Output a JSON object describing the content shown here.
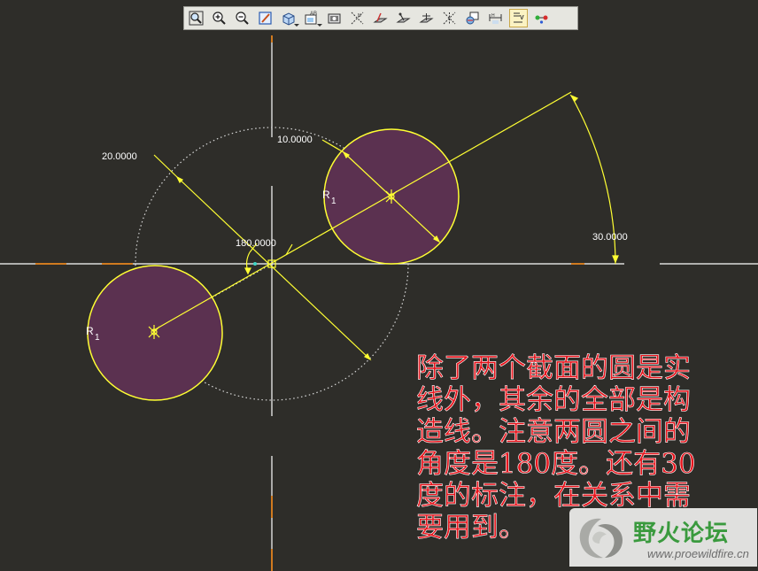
{
  "toolbar": {
    "buttons": [
      {
        "name": "refit-button",
        "icon": "zoom-fit-icon"
      },
      {
        "name": "zoom-in-button",
        "icon": "zoom-in-icon"
      },
      {
        "name": "zoom-out-button",
        "icon": "zoom-out-icon"
      },
      {
        "name": "repaint-button",
        "icon": "repaint-icon"
      },
      {
        "name": "view-orient-button",
        "icon": "cube-view-icon"
      },
      {
        "name": "saved-views-button",
        "icon": "saved-views-icon"
      },
      {
        "name": "orient-sketch-button",
        "icon": "sketch-orient-icon"
      },
      {
        "name": "datum-axes-button",
        "icon": "datum-axes-icon"
      },
      {
        "name": "datum-planes-button",
        "icon": "datum-planes-icon"
      },
      {
        "name": "datum-points-button",
        "icon": "datum-points-icon"
      },
      {
        "name": "coordinate-systems-button",
        "icon": "csys-icon"
      },
      {
        "name": "spin-center-button",
        "icon": "spin-center-icon"
      },
      {
        "name": "annotations-button",
        "icon": "annotations-icon"
      },
      {
        "name": "dimensions-toggle-button",
        "icon": "dimensions-icon"
      },
      {
        "name": "constraints-toggle-button",
        "icon": "constraints-icon",
        "active": true
      },
      {
        "name": "vertices-toggle-button",
        "icon": "vertices-icon"
      }
    ]
  },
  "sketch": {
    "dimensions": {
      "diameter_construction": "20.0000",
      "diameter_section": "10.0000",
      "angle_between": "180.0000",
      "angle_ref": "30.0000"
    },
    "relation_label": "R",
    "relation_index": "1",
    "colors": {
      "background": "#2e2d29",
      "section_fill": "#5b3150",
      "dimension": "#ffff33",
      "centerline": "#ffffff",
      "construction": "#d8d8d8",
      "axis_marker": "#d07a1f"
    }
  },
  "annotation_note": {
    "lines": [
      "除了两个截面的圆是实",
      "线外，其余的全部是构",
      "造线。注意两圆之间的",
      "角度是180度。还有30",
      "度的标注，在关系中需",
      "要用到。"
    ],
    "color": "#e8141c"
  },
  "watermark": {
    "title": "野火论坛",
    "url": "www.proewildfire.cn"
  }
}
